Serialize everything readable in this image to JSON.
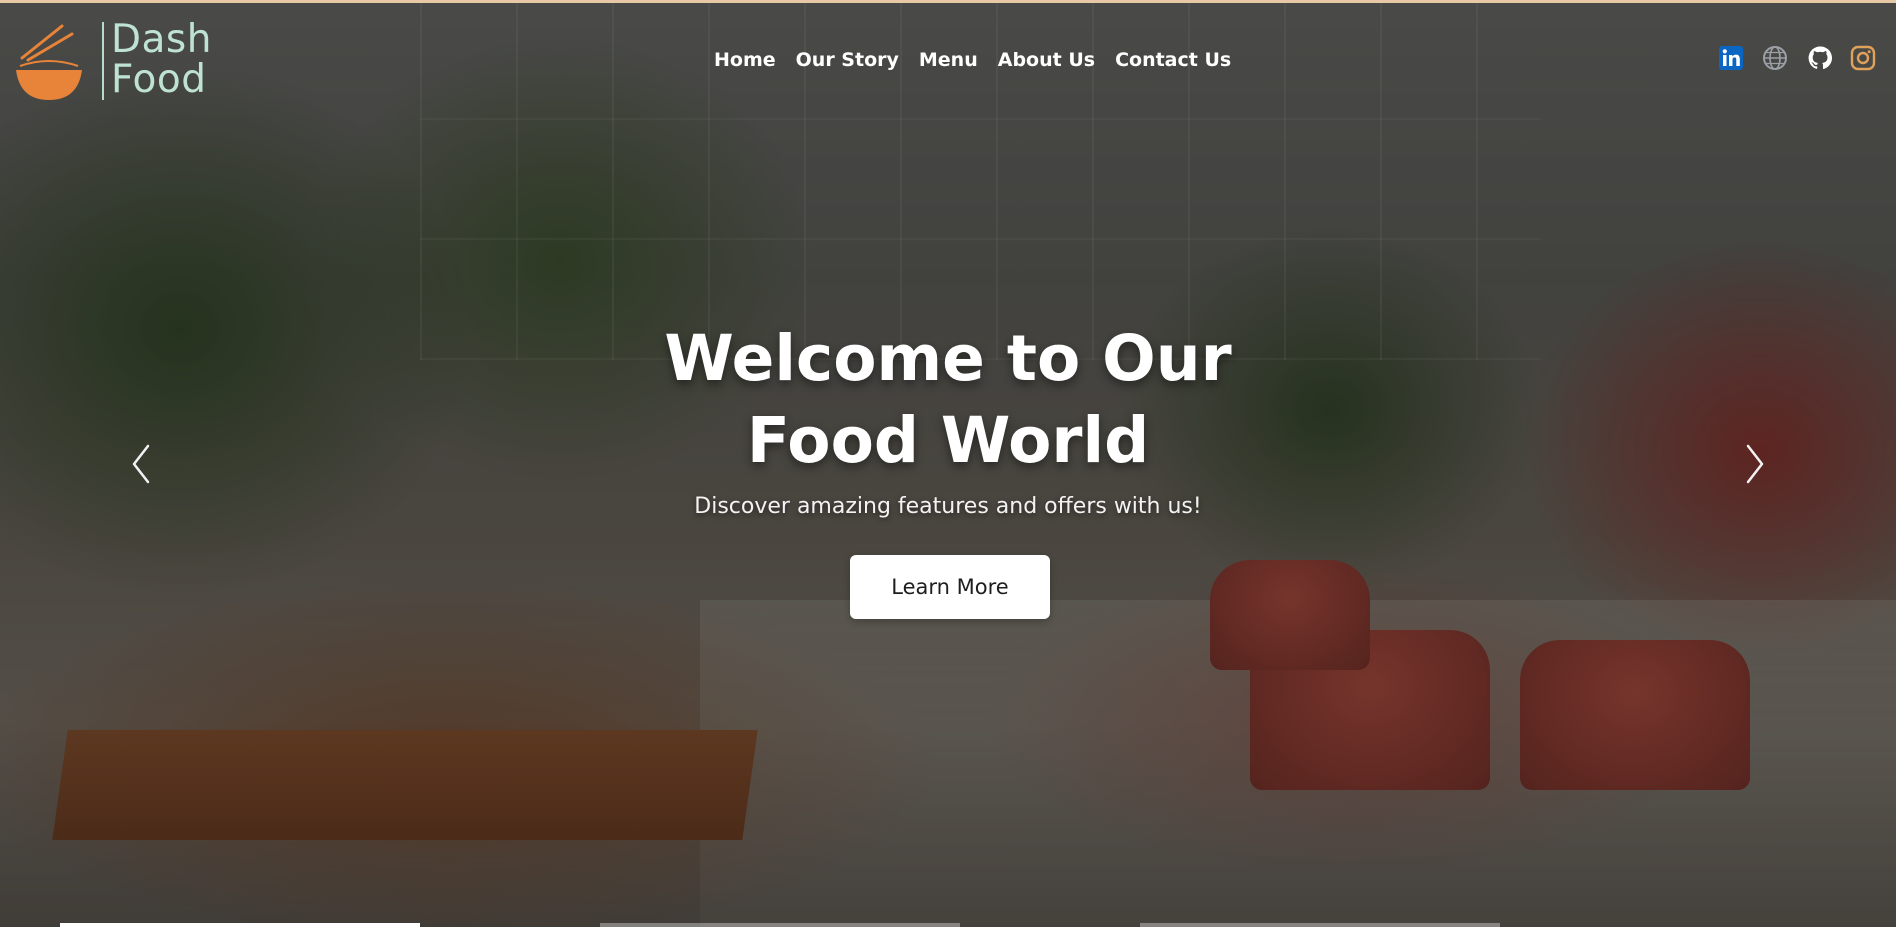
{
  "brand": {
    "logo_line1": "Dash",
    "logo_line2": "Food"
  },
  "nav": {
    "items": [
      {
        "label": "Home"
      },
      {
        "label": "Our Story"
      },
      {
        "label": "Menu"
      },
      {
        "label": "About Us"
      },
      {
        "label": "Contact Us"
      }
    ]
  },
  "social": {
    "icons": [
      "linkedin-icon",
      "globe-icon",
      "github-icon",
      "instagram-icon"
    ],
    "colors": {
      "linkedin": "#0a66c2",
      "globe": "#9aa0a6",
      "github": "#ffffff",
      "instagram": "#e0a15a"
    }
  },
  "hero": {
    "headline_line1": "Welcome to Our",
    "headline_line2": "Food World",
    "subtitle": "Discover amazing features and offers with us!",
    "cta_label": "Learn More"
  },
  "carousel": {
    "prev_icon": "chevron-left-icon",
    "next_icon": "chevron-right-icon",
    "slide_count": 3,
    "active_slide": 1
  },
  "colors": {
    "logo_accent": "#e8843a",
    "logo_text": "#bfe3d2",
    "top_border": "#e7c9a6"
  }
}
